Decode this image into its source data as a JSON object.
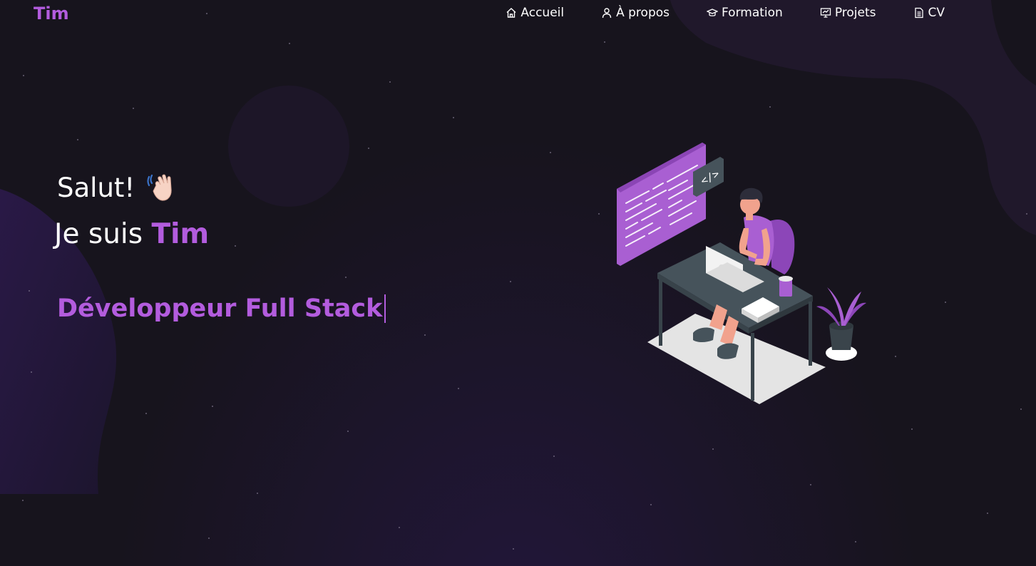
{
  "brand": {
    "logo": "Tim"
  },
  "nav": {
    "items": [
      {
        "label": "Accueil",
        "icon": "home-icon"
      },
      {
        "label": "À propos",
        "icon": "user-icon"
      },
      {
        "label": "Formation",
        "icon": "graduation-cap-icon"
      },
      {
        "label": "Projets",
        "icon": "presentation-icon"
      },
      {
        "label": "CV",
        "icon": "document-icon"
      }
    ]
  },
  "hero": {
    "greeting": "Salut!",
    "greeting_icon": "waving-hand-icon",
    "intro_prefix": "Je suis",
    "name": "Tim",
    "role": "Développeur Full Stack"
  },
  "illustration": {
    "code_tag": "</>",
    "subject": "developer-at-desk-illustration"
  },
  "colors": {
    "accent": "#b35cde",
    "background": "#17141d",
    "blob": "#2a1a45",
    "text": "#ffffff"
  }
}
